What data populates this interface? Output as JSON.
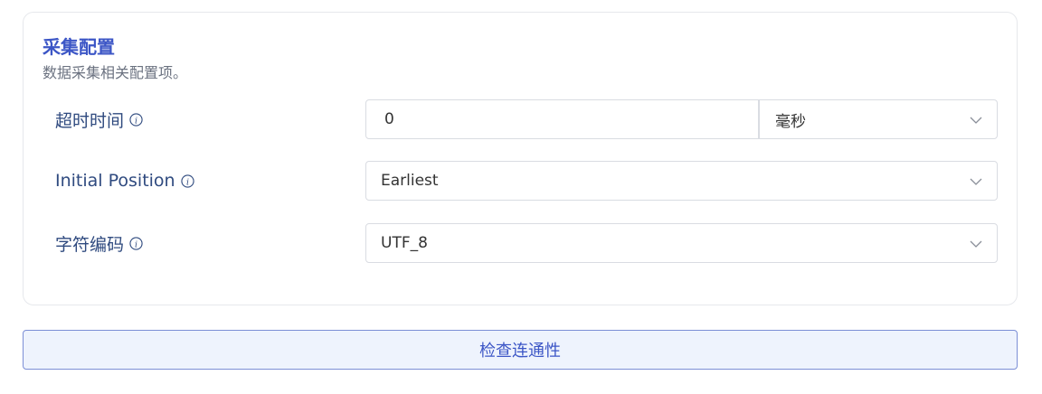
{
  "section": {
    "title": "采集配置",
    "description": "数据采集相关配置项。"
  },
  "fields": {
    "timeout": {
      "label": "超时时间",
      "value": "0",
      "unit": "毫秒"
    },
    "initial_position": {
      "label": "Initial Position",
      "value": "Earliest"
    },
    "encoding": {
      "label": "字符编码",
      "value": "UTF_8"
    }
  },
  "actions": {
    "check_connectivity": "检查连通性"
  },
  "colors": {
    "accent": "#3c56c6",
    "label": "#2f4a7f",
    "button_bg": "#eef3fd"
  }
}
